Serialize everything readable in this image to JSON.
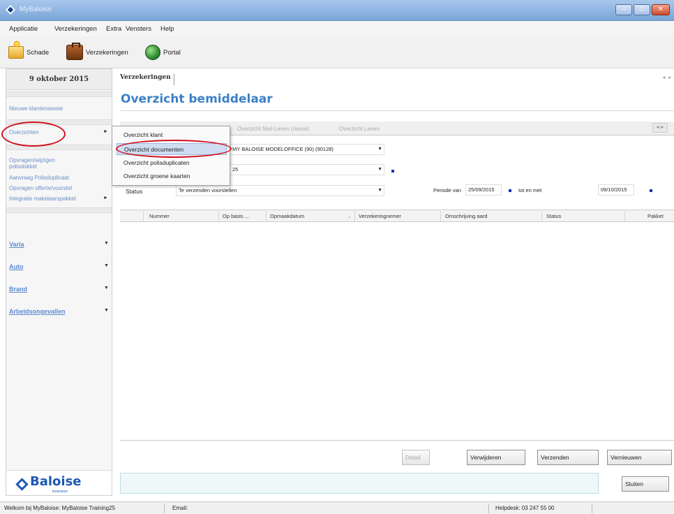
{
  "window": {
    "title": "MyBaloise"
  },
  "menu": [
    "Applicatie",
    "Verzekeringen",
    "Extra",
    "Vensters",
    "Help"
  ],
  "toolbar": {
    "schade": "Schade",
    "verzekeringen": "Verzekeringen",
    "portal": "Portal"
  },
  "sidebar": {
    "date": "9 oktober 2015",
    "links": {
      "nieuwe": "Nieuwe klantensessie",
      "overzichten": "Overzichten",
      "opvragen_line1": "Opvragen/wijzigen",
      "opvragen_line2": "polisdokket",
      "aanvraag": "Aanvraag Polisduplicaat",
      "offerte": "Opvragen offerte/voorstel",
      "integratie": "Integratie makelaarspakket"
    },
    "categories": [
      "Varia",
      "Auto",
      "Brand",
      "Arbeidsongevallen"
    ],
    "logo": {
      "name": "Baloise",
      "sub": "Insurance"
    }
  },
  "main": {
    "tab": "Verzekeringen",
    "title": "Overzicht bemiddelaar",
    "subtabs": [
      "Overzicht Niet-Leven (nieuw)",
      "Overzicht Leven"
    ],
    "fields": {
      "intermediary": "MY BALOISE MODELOFFICE (90) (90128)",
      "user_partial": "25",
      "status_label": "Status",
      "status_value": "Te verzenden voorstellen",
      "periode_label": "Periode van",
      "periode_from": "25/09/2015",
      "tot_label": "tot en met",
      "periode_to": "09/10/2015"
    },
    "columns": [
      "Nummer",
      "Op basis ...",
      "Opmaakdatum",
      "Verzekeringnemer",
      "Omschrijving aard",
      "Status",
      "Pakket"
    ],
    "buttons": {
      "detail": "Detail",
      "verwijderen": "Verwijderen",
      "verzenden": "Verzenden",
      "vernieuwen": "Vernieuwen",
      "sluiten": "Sluiten"
    }
  },
  "popup": [
    "Overzicht klant",
    "Overzicht documenten",
    "Overzicht polisduplicaten",
    "Overzicht groene kaarten"
  ],
  "statusbar": {
    "welcome": "Welkom bij MyBaloise: MyBaloise Training25",
    "email": "Email:",
    "helpdesk": "Helpdesk: 03 247 55 00"
  }
}
